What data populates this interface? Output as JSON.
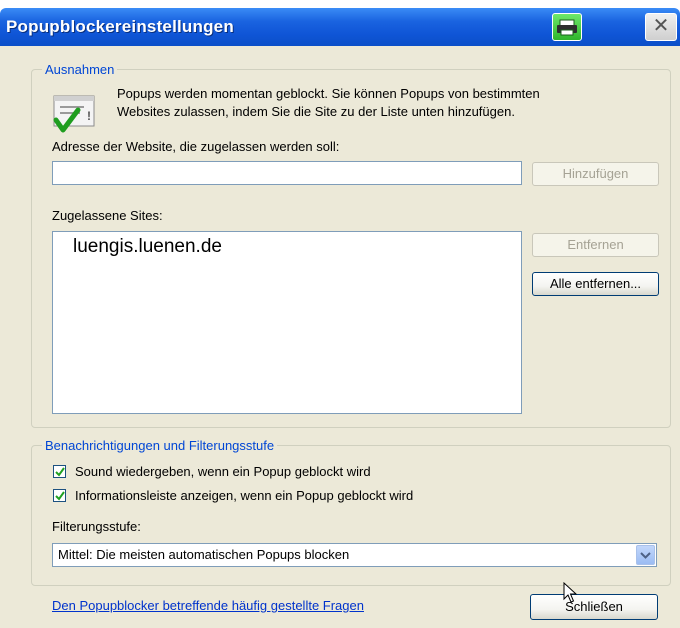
{
  "window": {
    "title": "Popupblockereinstellungen",
    "close_glyph": "✕"
  },
  "exceptions": {
    "legend": "Ausnahmen",
    "info_line1": "Popups werden momentan geblockt. Sie können Popups von bestimmten",
    "info_line2": "Websites zulassen, indem Sie die Site zu der Liste unten hinzufügen.",
    "address_label": "Adresse der Website, die zugelassen werden soll:",
    "address_value": "",
    "add_button": "Hinzufügen",
    "allowed_label": "Zugelassene Sites:",
    "allowed_sites": [
      "luengis.luenen.de"
    ],
    "remove_button": "Entfernen",
    "remove_all_button": "Alle entfernen..."
  },
  "notifications": {
    "legend": "Benachrichtigungen und Filterungsstufe",
    "play_sound_label": "Sound wiedergeben, wenn ein Popup geblockt wird",
    "play_sound_checked": true,
    "infobar_label": "Informationsleiste anzeigen, wenn ein Popup geblockt wird",
    "infobar_checked": true,
    "filter_label": "Filterungsstufe:",
    "filter_value": "Mittel: Die meisten automatischen Popups blocken"
  },
  "footer": {
    "faq_link": "Den Popupblocker betreffende häufig gestellte Fragen",
    "close_button": "Schließen"
  },
  "icons": {
    "title_green": "printer-icon",
    "info": "popup-checkmark-icon",
    "dropdown": "chevron-down-icon",
    "cursor": "mouse-pointer-icon"
  }
}
